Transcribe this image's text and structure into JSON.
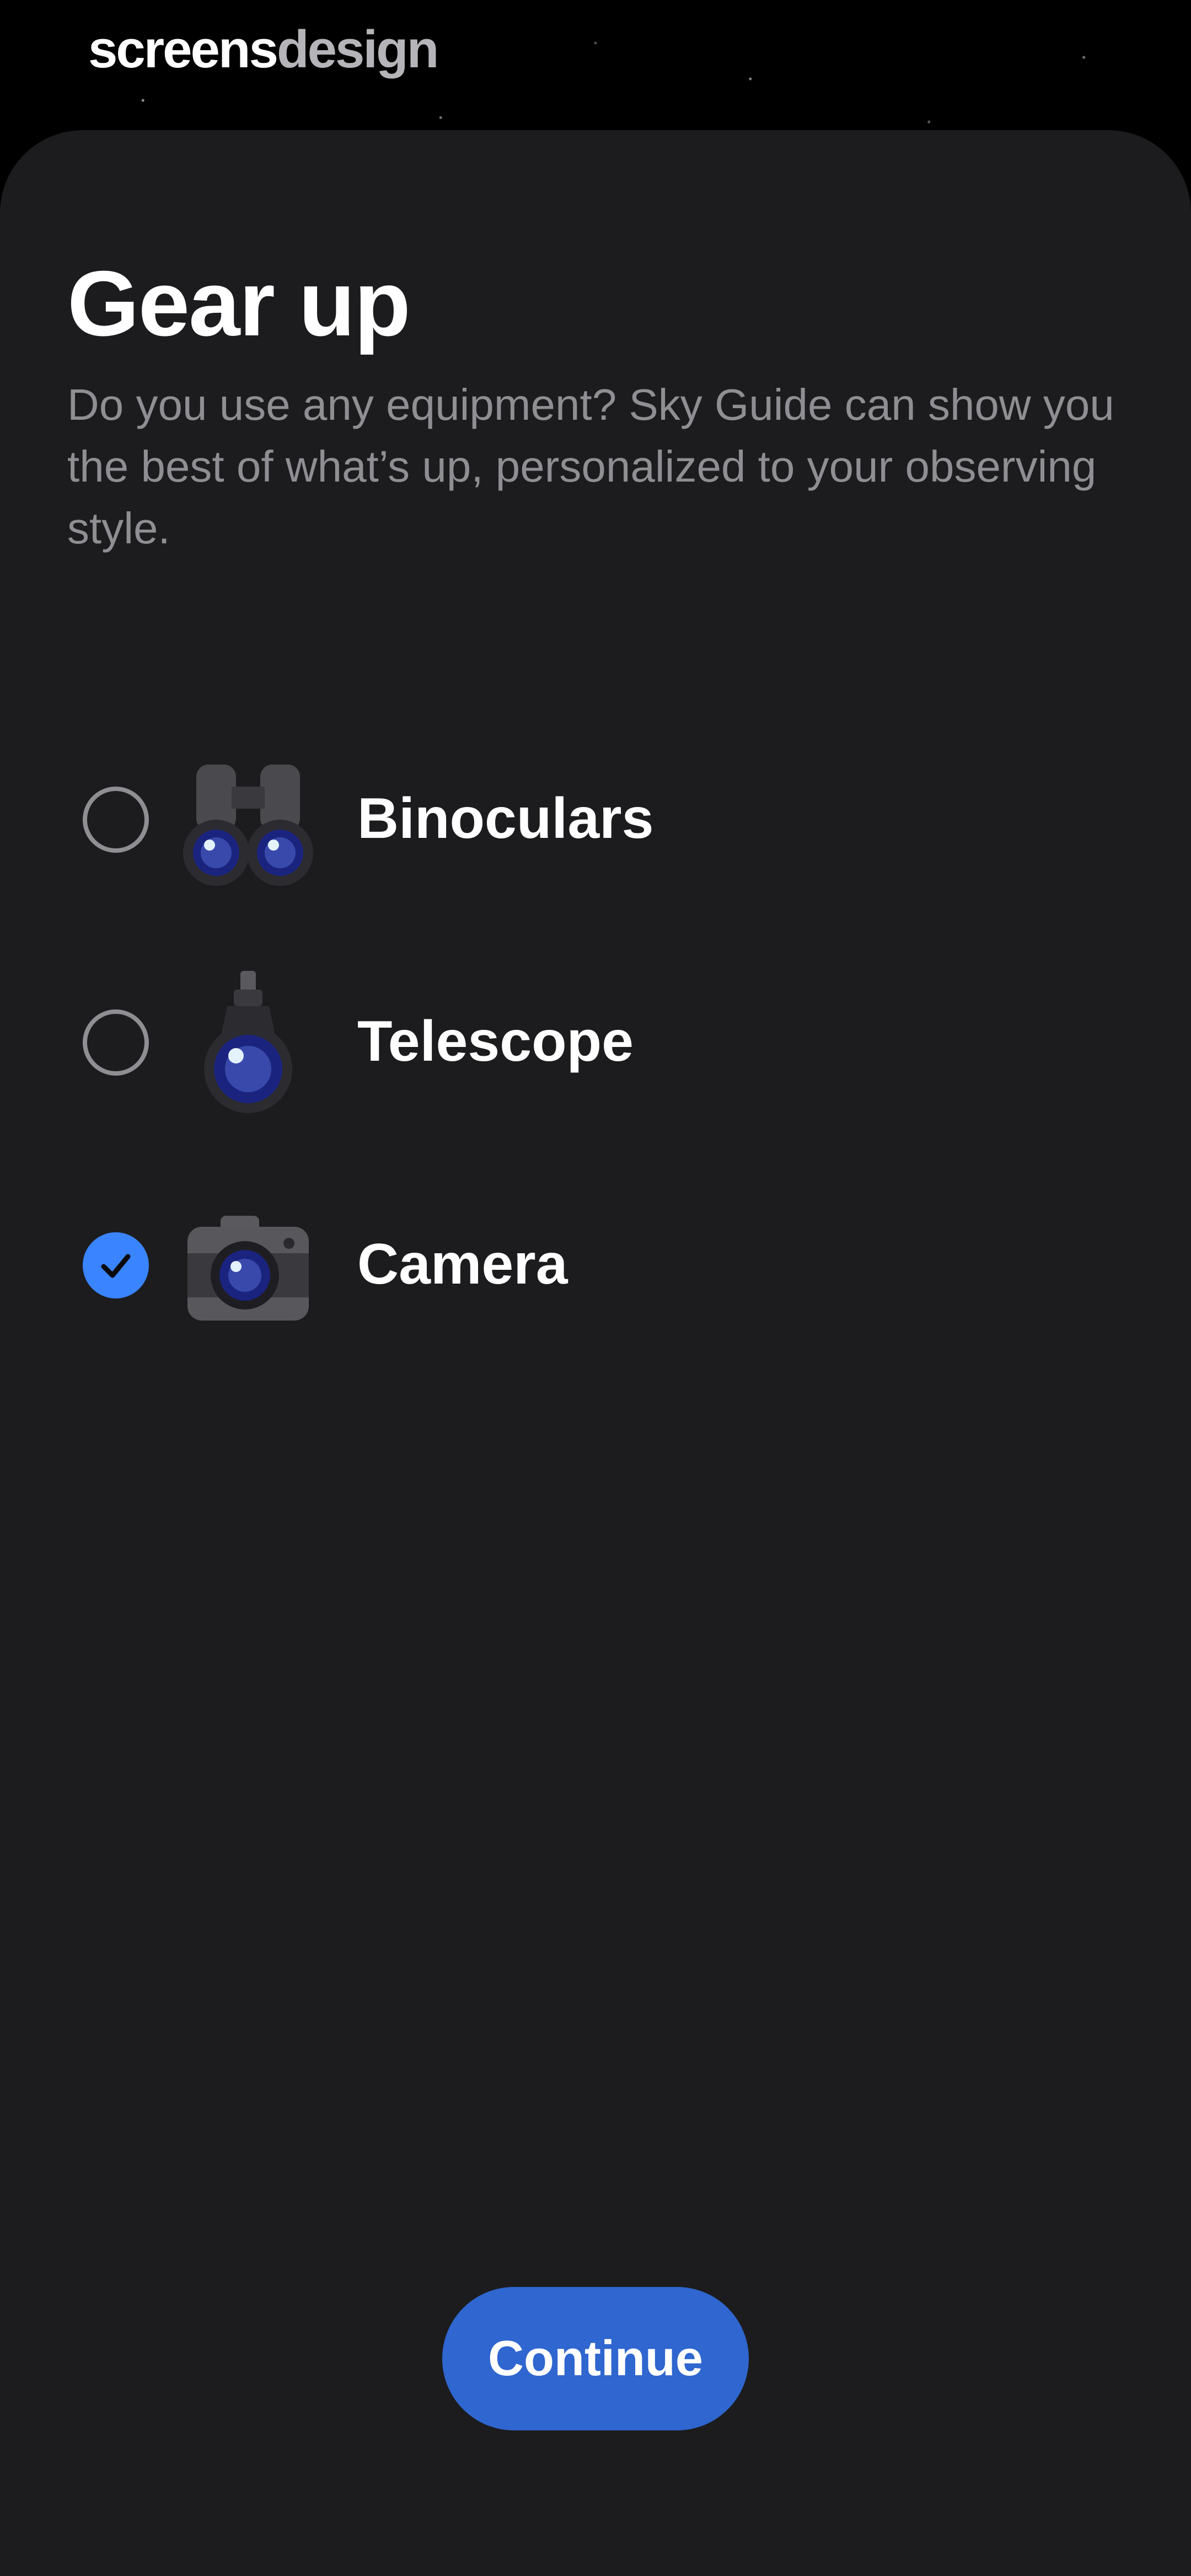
{
  "brand": {
    "part1": "screens",
    "part2": "design"
  },
  "title": "Gear up",
  "subtitle": "Do you use any equipment? Sky Guide can show you the best of what’s up, personalized to your observing style.",
  "options": [
    {
      "label": "Binoculars",
      "icon": "binoculars-icon",
      "checked": false
    },
    {
      "label": "Telescope",
      "icon": "telescope-icon",
      "checked": false
    },
    {
      "label": "Camera",
      "icon": "camera-icon",
      "checked": true
    }
  ],
  "continue_label": "Continue",
  "colors": {
    "background": "#000000",
    "sheet": "#1c1c1e",
    "accent": "#3a84ff",
    "button": "#2f66cf",
    "secondary_text": "#8e8e93"
  }
}
